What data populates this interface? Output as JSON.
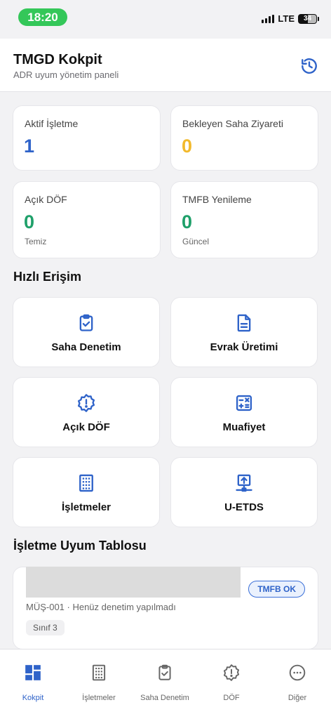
{
  "status_bar": {
    "time": "18:20",
    "network": "LTE",
    "battery": "34"
  },
  "header": {
    "title": "TMGD Kokpit",
    "subtitle": "ADR uyum yönetim paneli"
  },
  "stats": [
    {
      "label": "Aktif İşletme",
      "value": "1",
      "note": "",
      "color": "#2f63c9"
    },
    {
      "label": "Bekleyen Saha Ziyareti",
      "value": "0",
      "note": "",
      "color": "#f2b92c"
    },
    {
      "label": "Açık DÖF",
      "value": "0",
      "note": "Temiz",
      "color": "#1fa06a"
    },
    {
      "label": "TMFB Yenileme",
      "value": "0",
      "note": "Güncel",
      "color": "#1fa06a"
    }
  ],
  "quick_access": {
    "title": "Hızlı Erişim",
    "tiles": [
      {
        "label": "Saha Denetim",
        "icon": "clipboard-check-icon"
      },
      {
        "label": "Evrak Üretimi",
        "icon": "document-icon"
      },
      {
        "label": "Açık DÖF",
        "icon": "alert-badge-icon"
      },
      {
        "label": "Muafiyet",
        "icon": "calculator-icon"
      },
      {
        "label": "İşletmeler",
        "icon": "building-icon"
      },
      {
        "label": "U-ETDS",
        "icon": "upload-network-icon"
      }
    ]
  },
  "compliance": {
    "title": "İşletme Uyum Tablosu",
    "badge": "TMFB OK",
    "description": "MÜŞ-001 · Henüz denetim yapılmadı",
    "class_label": "Sınıf 3"
  },
  "tabs": [
    {
      "label": "Kokpit",
      "icon": "dashboard-icon",
      "active": true
    },
    {
      "label": "İşletmeler",
      "icon": "building-icon",
      "active": false
    },
    {
      "label": "Saha Denetim",
      "icon": "clipboard-check-icon",
      "active": false
    },
    {
      "label": "DÖF",
      "icon": "alert-badge-icon",
      "active": false
    },
    {
      "label": "Diğer",
      "icon": "more-icon",
      "active": false
    }
  ],
  "colors": {
    "accent": "#2f63c9",
    "success": "#1fa06a",
    "warning": "#f2b92c",
    "status_green": "#34c759"
  }
}
